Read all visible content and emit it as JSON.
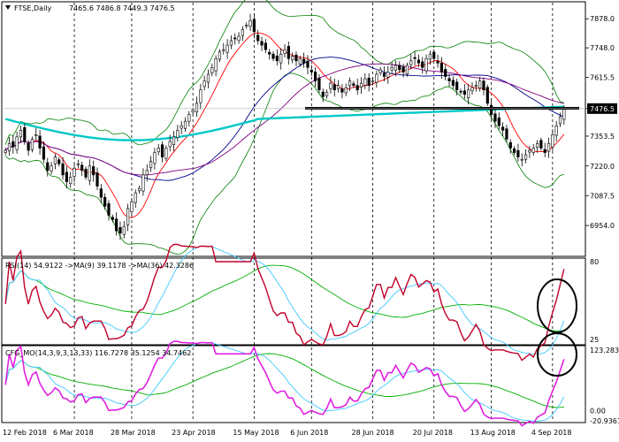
{
  "header": {
    "symbol": "FTSE,Daily",
    "ohlc": "7465.6 7486.8 7449.3 7476.5"
  },
  "chart_data": [
    {
      "type": "candlestick",
      "panel": "price",
      "title": "FTSE,Daily",
      "ohlc_last": {
        "open": 7465.6,
        "high": 7486.8,
        "low": 7449.3,
        "close": 7476.5
      },
      "last_price": "7476.5",
      "ylim": [
        6820,
        7950
      ],
      "y_ticks": [
        6954.0,
        7087.5,
        7220.0,
        7353.5,
        7476.5,
        7615.5,
        7748.0,
        7878.0
      ],
      "y_tick_labels": [
        "6954.0",
        "7087.5",
        "7220.0",
        "7353.5",
        "7476.5",
        "7615.5",
        "7748.0",
        "7878.0"
      ],
      "x_labels": [
        "12 Feb 2018",
        "6 Mar 2018",
        "28 Mar 2018",
        "23 Apr 2018",
        "15 May 2018",
        "6 Jun 2018",
        "28 Jun 2018",
        "20 Jul 2018",
        "13 Aug 2018",
        "4 Sep 2018"
      ],
      "support_level": 7478,
      "close_series": [
        7290,
        7320,
        7305,
        7350,
        7380,
        7330,
        7290,
        7340,
        7360,
        7300,
        7250,
        7200,
        7220,
        7260,
        7230,
        7180,
        7150,
        7170,
        7210,
        7230,
        7200,
        7170,
        7220,
        7180,
        7130,
        7080,
        7040,
        7000,
        6980,
        6930,
        6920,
        6950,
        7030,
        7060,
        7100,
        7120,
        7180,
        7200,
        7240,
        7280,
        7300,
        7260,
        7300,
        7330,
        7350,
        7380,
        7400,
        7420,
        7450,
        7470,
        7500,
        7560,
        7600,
        7630,
        7660,
        7700,
        7730,
        7740,
        7760,
        7780,
        7790,
        7800,
        7830,
        7850,
        7870,
        7820,
        7780,
        7760,
        7740,
        7720,
        7700,
        7690,
        7720,
        7740,
        7700,
        7710,
        7690,
        7700,
        7680,
        7660,
        7640,
        7600,
        7560,
        7530,
        7550,
        7590,
        7560,
        7580,
        7550,
        7570,
        7600,
        7580,
        7560,
        7590,
        7610,
        7580,
        7600,
        7630,
        7650,
        7620,
        7640,
        7660,
        7670,
        7650,
        7640,
        7670,
        7690,
        7700,
        7680,
        7660,
        7700,
        7720,
        7700,
        7680,
        7640,
        7620,
        7600,
        7580,
        7560,
        7550,
        7540,
        7560,
        7570,
        7580,
        7600,
        7560,
        7500,
        7450,
        7420,
        7400,
        7380,
        7340,
        7300,
        7280,
        7260,
        7250,
        7270,
        7290,
        7300,
        7320,
        7300,
        7280,
        7320,
        7360,
        7400,
        7440,
        7476.5
      ],
      "series": [
        {
          "name": "",
          "color": "#ff0000",
          "kind": "fast moving average"
        },
        {
          "name": "",
          "color": "#00008b",
          "kind": "moving average"
        },
        {
          "name": "",
          "color": "#800080",
          "kind": "moving average"
        },
        {
          "name": "",
          "color": "#00c8c8",
          "kind": "slow moving average"
        },
        {
          "name": "",
          "color": "#008000",
          "kind": "bollinger band upper"
        },
        {
          "name": "",
          "color": "#008000",
          "kind": "bollinger band lower"
        }
      ]
    },
    {
      "type": "line",
      "panel": "rsi",
      "label": "RSI(14) 54.9122 ->MA(9) 39.1178 ->MA(36) 42.3286",
      "ylim": [
        25,
        80
      ],
      "y_ticks": [
        25,
        80
      ],
      "y_tick_labels": [
        "25",
        "80"
      ],
      "series": [
        {
          "name": "RSI(14)",
          "last": 54.9122,
          "color": "#c0002a"
        },
        {
          "name": "MA(9)",
          "last": 39.1178,
          "color": "#40c8ff"
        },
        {
          "name": "MA(36)",
          "last": 42.3286,
          "color": "#00b000"
        }
      ]
    },
    {
      "type": "line",
      "panel": "cfg_mo",
      "label": "CFG_MO(14,3,9,3,13,33) 116.7278 35.1254 34.7462",
      "ylim": [
        -20.9361,
        123.2832
      ],
      "y_ticks": [
        0,
        123.2832,
        -20.9361
      ],
      "y_tick_labels": [
        "0.00",
        "123.2832",
        "-20.9361"
      ],
      "series": [
        {
          "name": "CFG_MO",
          "last": 116.7278,
          "color": "#e020e0"
        },
        {
          "name": "signal 1",
          "last": 35.1254,
          "color": "#40c8ff"
        },
        {
          "name": "signal 2",
          "last": 34.7462,
          "color": "#00b000"
        }
      ]
    }
  ]
}
